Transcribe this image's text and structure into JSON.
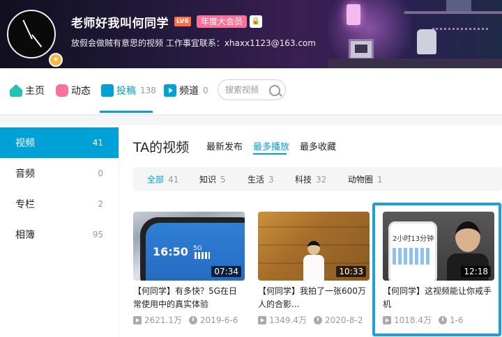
{
  "profile": {
    "username": "老师好我叫何同学",
    "level": "LV6",
    "vip": "年度大会员",
    "gender_icon": "gender-private",
    "bio": "放假会做贼有意思的视频 工作事宜联系：xhaxx1123@163.com"
  },
  "nav": {
    "tabs": [
      {
        "label": "主页",
        "icon": "home-icon"
      },
      {
        "label": "动态",
        "icon": "dynamic-icon"
      },
      {
        "label": "投稿",
        "count": "138",
        "icon": "upload-icon",
        "active": true
      },
      {
        "label": "频道",
        "count": "0",
        "icon": "channel-icon"
      }
    ],
    "search_placeholder": "搜索视频"
  },
  "sidebar": {
    "items": [
      {
        "label": "视频",
        "count": "41",
        "active": true
      },
      {
        "label": "音频",
        "count": "0"
      },
      {
        "label": "专栏",
        "count": "2"
      },
      {
        "label": "相簿",
        "count": "95"
      }
    ]
  },
  "main": {
    "title": "TA的视频",
    "sort": [
      "最新发布",
      "最多播放",
      "最多收藏"
    ],
    "sort_active": "最多播放",
    "filters": [
      {
        "label": "全部",
        "count": "41",
        "active": true
      },
      {
        "label": "知识",
        "count": "5"
      },
      {
        "label": "生活",
        "count": "3"
      },
      {
        "label": "科技",
        "count": "32"
      },
      {
        "label": "动物圈",
        "count": "1"
      }
    ],
    "videos": [
      {
        "duration": "07:34",
        "thumb_text": "16:50",
        "thumb_sub": "5G",
        "title": "【何同学】有多快？5G在日常使用中的真实体验",
        "plays": "2621.1万",
        "date": "2019-6-6"
      },
      {
        "duration": "10:33",
        "title": "【何同学】我拍了一张600万人的合影...",
        "plays": "1349.4万",
        "date": "2020-8-2"
      },
      {
        "duration": "12:18",
        "thumb_text": "2小时13分钟",
        "title": "【何同学】这视频能让你戒手机",
        "plays": "1018.4万",
        "date": "1-6",
        "highlighted": true
      }
    ]
  },
  "colors": {
    "accent": "#00a1d6",
    "vip_pink": "#fb7299",
    "level_orange": "#ff6b45",
    "highlight_border": "#1da0dd"
  }
}
